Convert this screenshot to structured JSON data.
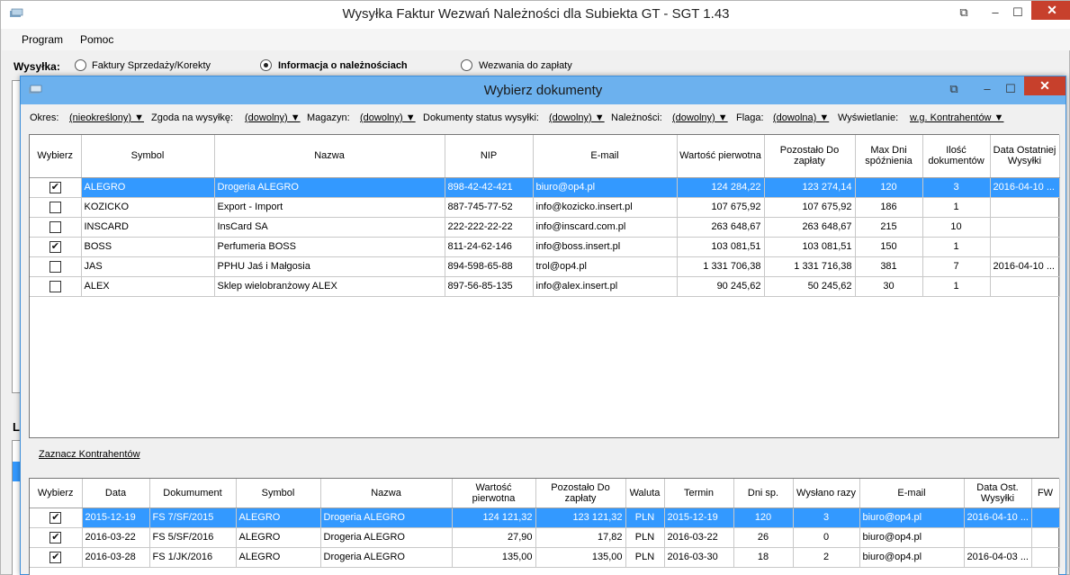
{
  "main": {
    "title": "Wysyłka Faktur Wezwań Należności dla Subiekta GT - SGT 1.43",
    "menu": [
      "Program",
      "Pomoc"
    ],
    "wysylka_label": "Wysyłka:",
    "options": [
      {
        "label": "Faktury Sprzedaży/Korekty",
        "selected": false
      },
      {
        "label": "Informacja o należnościach",
        "selected": true
      },
      {
        "label": "Wezwania do zapłaty",
        "selected": false
      }
    ],
    "side_letter": "L"
  },
  "dialog": {
    "title": "Wybierz dokumenty",
    "filters": {
      "okres_label": "Okres:",
      "okres_value": "(nieokreślony) ▼",
      "zgoda_label": "Zgoda na wysyłkę:",
      "zgoda_value": "(dowolny) ▼",
      "magazyn_label": "Magazyn:",
      "magazyn_value": "(dowolny) ▼",
      "status_label": "Dokumenty status wysyłki:",
      "status_value": "(dowolny) ▼",
      "naleznosci_label": "Należności:",
      "naleznosci_value": "(dowolny) ▼",
      "flaga_label": "Flaga:",
      "flaga_value": "(dowolna) ▼",
      "wyswietlanie_label": "Wyświetlanie:",
      "wyswietlanie_value": "w.g. Kontrahentów ▼"
    },
    "top_grid": {
      "headers": [
        "Wybierz",
        "Symbol",
        "Nazwa",
        "NIP",
        "E-mail",
        "Wartość pierwotna",
        "Pozostało Do zapłaty",
        "Max Dni spóźnienia",
        "Ilość dokumentów",
        "Data Ostatniej Wysyłki"
      ],
      "rows": [
        {
          "checked": true,
          "cells": [
            "ALEGRO",
            "Drogeria ALEGRO",
            "898-42-42-421",
            "biuro@op4.pl",
            "124 284,22",
            "123 274,14",
            "120",
            "3",
            "2016-04-10 ..."
          ]
        },
        {
          "checked": false,
          "cells": [
            "KOZICKO",
            "Export - Import",
            "887-745-77-52",
            "info@kozicko.insert.pl",
            "107 675,92",
            "107 675,92",
            "186",
            "1",
            ""
          ]
        },
        {
          "checked": false,
          "cells": [
            "INSCARD",
            "InsCard SA",
            "222-222-22-22",
            "info@inscard.com.pl",
            "263 648,67",
            "263 648,67",
            "215",
            "10",
            ""
          ]
        },
        {
          "checked": true,
          "cells": [
            "BOSS",
            "Perfumeria BOSS",
            "811-24-62-146",
            "info@boss.insert.pl",
            "103 081,51",
            "103 081,51",
            "150",
            "1",
            ""
          ]
        },
        {
          "checked": false,
          "cells": [
            "JAS",
            "PPHU Jaś i Małgosia",
            "894-598-65-88",
            "trol@op4.pl",
            "1 331 706,38",
            "1 331 716,38",
            "381",
            "7",
            "2016-04-10 ..."
          ]
        },
        {
          "checked": false,
          "cells": [
            "ALEX",
            "Sklep wielobranżowy  ALEX",
            "897-56-85-135",
            "info@alex.insert.pl",
            "90 245,62",
            "50 245,62",
            "30",
            "1",
            ""
          ]
        }
      ]
    },
    "link_label": "Zaznacz Kontrahentów",
    "bottom_grid": {
      "headers": [
        "Wybierz",
        "Data",
        "Dokumument",
        "Symbol",
        "Nazwa",
        "Wartość pierwotna",
        "Pozostało Do zapłaty",
        "Waluta",
        "Termin",
        "Dni sp.",
        "Wysłano razy",
        "E-mail",
        "Data Ost. Wysyłki",
        "FW"
      ],
      "rows": [
        {
          "checked": true,
          "cells": [
            "2015-12-19",
            "FS 7/SF/2015",
            "ALEGRO",
            "Drogeria ALEGRO",
            "124 121,32",
            "123 121,32",
            "PLN",
            "2015-12-19",
            "120",
            "3",
            "biuro@op4.pl",
            "2016-04-10 ...",
            ""
          ]
        },
        {
          "checked": true,
          "cells": [
            "2016-03-22",
            "FS 5/SF/2016",
            "ALEGRO",
            "Drogeria ALEGRO",
            "27,90",
            "17,82",
            "PLN",
            "2016-03-22",
            "26",
            "0",
            "biuro@op4.pl",
            "",
            ""
          ]
        },
        {
          "checked": true,
          "cells": [
            "2016-03-28",
            "FS 1/JK/2016",
            "ALEGRO",
            "Drogeria ALEGRO",
            "135,00",
            "135,00",
            "PLN",
            "2016-03-30",
            "18",
            "2",
            "biuro@op4.pl",
            "2016-04-03 ...",
            ""
          ]
        }
      ]
    }
  }
}
